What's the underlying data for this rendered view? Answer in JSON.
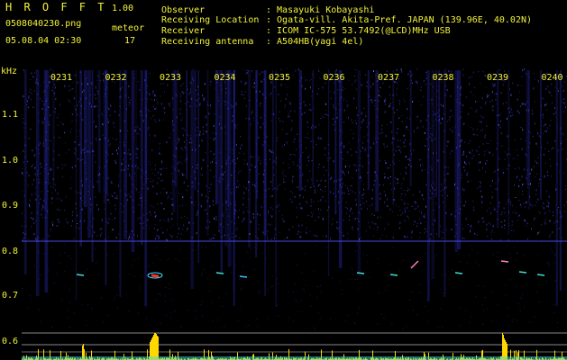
{
  "header": {
    "app_title": "H R O F F T",
    "version": "1.00",
    "filename": "0508040230.png",
    "datetime": "05.08.04 02:30",
    "meteor_label": "meteor",
    "meteor_count": "17",
    "info": [
      {
        "label": "Observer",
        "value": ": Masayuki Kobayashi"
      },
      {
        "label": "Receiving Location",
        "value": ": Ogata-vill. Akita-Pref. JAPAN (139.96E, 40.02N)"
      },
      {
        "label": "Receiver",
        "value": ": ICOM IC-575 53.7492(@LCD)MHz USB"
      },
      {
        "label": "Receiving antenna",
        "value": ": A504HB(yagi 4el)"
      }
    ]
  },
  "spectrogram": {
    "y_unit": "kHz",
    "y_ticks": [
      "1.1",
      "1.0",
      "0.9",
      "0.8",
      "0.7",
      "0.6"
    ],
    "x_ticks": [
      "0231",
      "0232",
      "0233",
      "0234",
      "0235",
      "0236",
      "0237",
      "0238",
      "0239",
      "0240"
    ],
    "colors": {
      "background": "#000000",
      "noise": "#3a3ad8",
      "text": "#f2f23a",
      "counts": "#ffd800",
      "signal": "#ff3030",
      "baseline": "#40e0d0"
    }
  }
}
